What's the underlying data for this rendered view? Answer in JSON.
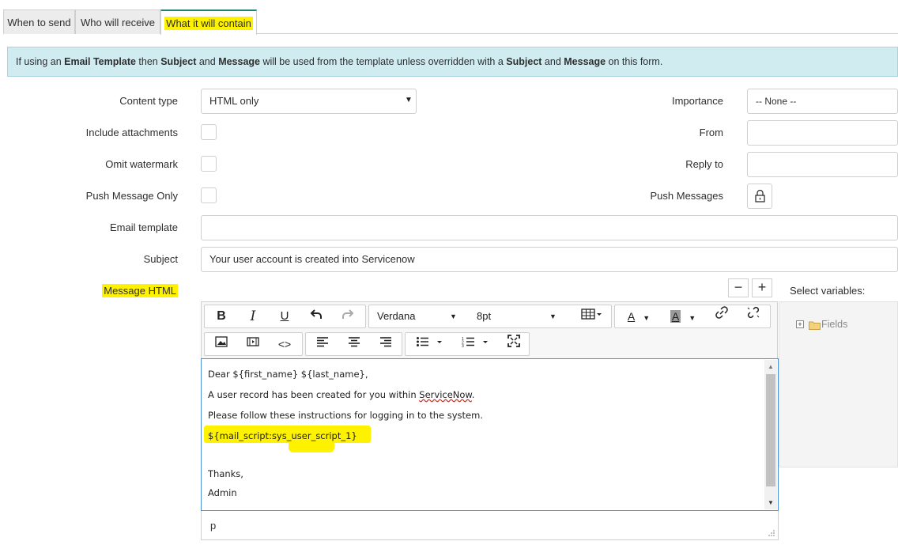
{
  "tabs": [
    {
      "label": "When to send"
    },
    {
      "label": "Who will receive"
    },
    {
      "label": "What it will contain"
    }
  ],
  "info": {
    "p1": "If using an ",
    "b1": "Email Template",
    "p2": " then ",
    "b2": "Subject",
    "p3": " and ",
    "b3": "Message",
    "p4": " will be used from the template unless overridden with a ",
    "b4": "Subject",
    "p5": " and ",
    "b5": "Message",
    "p6": " on this form."
  },
  "form": {
    "content_type_label": "Content type",
    "content_type_value": "HTML only",
    "include_attachments_label": "Include attachments",
    "omit_watermark_label": "Omit watermark",
    "push_message_only_label": "Push Message Only",
    "email_template_label": "Email template",
    "email_template_value": "",
    "subject_label": "Subject",
    "subject_value": "Your user account is created into Servicenow",
    "message_html_label": "Message HTML",
    "importance_label": "Importance",
    "importance_value": "-- None --",
    "from_label": "From",
    "from_value": "",
    "reply_to_label": "Reply to",
    "reply_to_value": "",
    "push_messages_label": "Push Messages"
  },
  "editor": {
    "font_family": "Verdana",
    "font_size": "8pt",
    "lines": [
      "Dear ${first_name} ${last_name},",
      "A user record has been created for you within ",
      "ServiceNow",
      ".",
      "Please follow these instructions for logging in to the system.",
      "${mail_script:sys_user_script_1}",
      "Thanks,",
      "Admin"
    ],
    "status_path": "p"
  },
  "variables": {
    "label": "Select variables:",
    "tree_root": "Fields"
  },
  "colors": {
    "highlight": "#fff200",
    "info_bg": "#d1ecf1",
    "tab_accent": "#1f8476",
    "folder": "#e8c35a"
  }
}
